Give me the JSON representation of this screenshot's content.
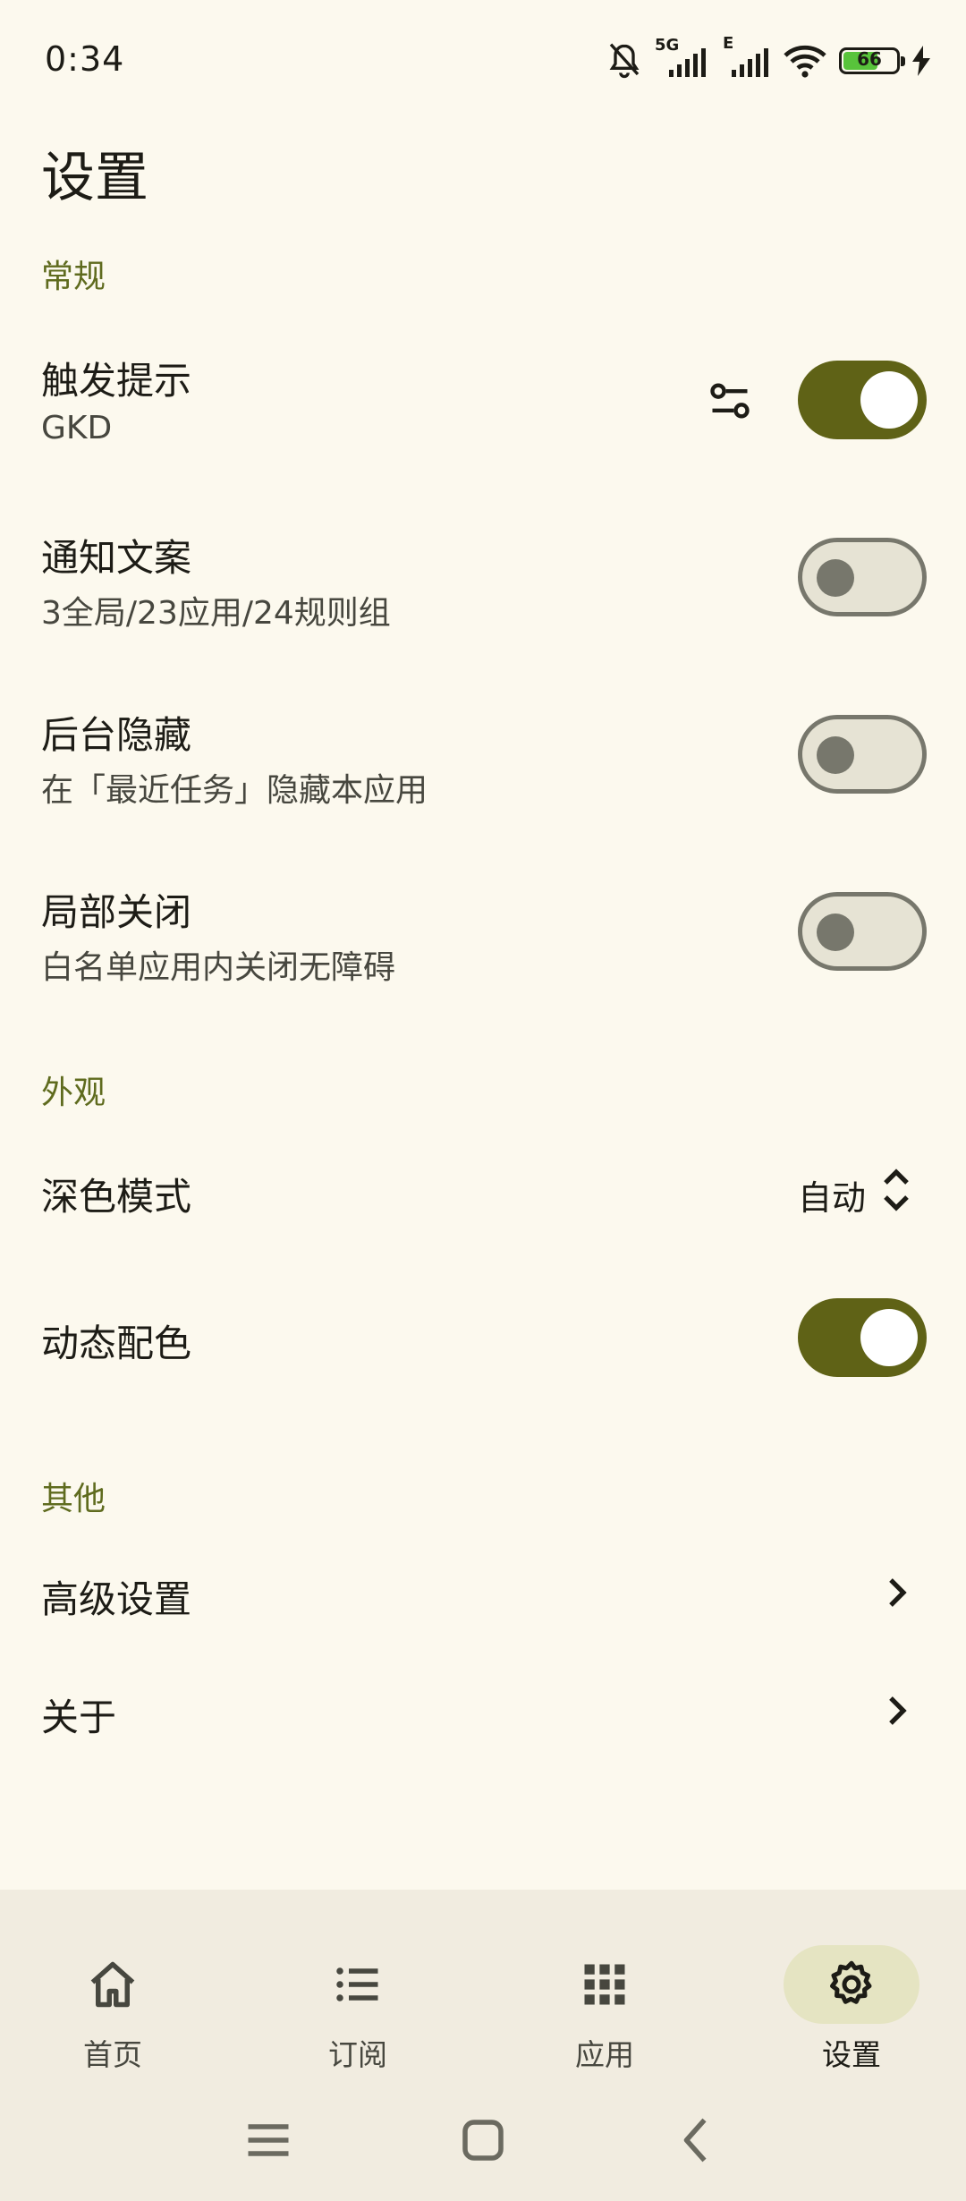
{
  "status": {
    "time": "0:34",
    "network_5g": "5G",
    "network_e": "E",
    "battery_level": "66",
    "icons": [
      "bell-off-icon",
      "signal-icon",
      "signal-icon",
      "wifi-icon",
      "battery-icon",
      "charging-icon"
    ]
  },
  "page_title": "设置",
  "sections": {
    "general": "常规",
    "appearance": "外观",
    "other": "其他"
  },
  "settings": {
    "trigger_hint": {
      "title": "触发提示",
      "subtitle": "GKD",
      "enabled": true
    },
    "notify_text": {
      "title": "通知文案",
      "subtitle": "3全局/23应用/24规则组",
      "enabled": false
    },
    "hide_background": {
      "title": "后台隐藏",
      "subtitle": "在「最近任务」隐藏本应用",
      "enabled": false
    },
    "partial_close": {
      "title": "局部关闭",
      "subtitle": "白名单应用内关闭无障碍",
      "enabled": false
    },
    "dark_mode": {
      "title": "深色模式",
      "value": "自动"
    },
    "dynamic_color": {
      "title": "动态配色",
      "enabled": true
    },
    "advanced": {
      "title": "高级设置"
    },
    "about": {
      "title": "关于"
    }
  },
  "nav": {
    "home": "首页",
    "subscribe": "订阅",
    "apps": "应用",
    "settings": "设置",
    "active": "settings"
  },
  "colors": {
    "background": "#FCF9EE",
    "accent": "#5F6216",
    "section_header": "#5F6B1E",
    "nav_active_pill": "#E5E4C2"
  }
}
